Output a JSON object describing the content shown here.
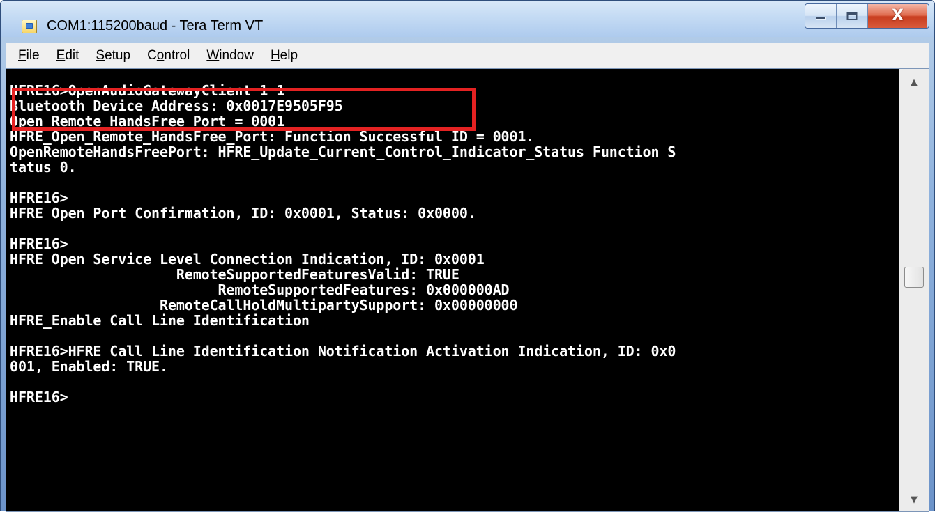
{
  "window": {
    "title": "COM1:115200baud - Tera Term VT",
    "app_icon": "tera-term-icon",
    "caption": {
      "minimize_icon": "minimize-icon",
      "maximize_icon": "maximize-icon",
      "close_icon": "close-icon",
      "close_glyph": "X",
      "close_color": "#d95a3b"
    }
  },
  "menu": {
    "items": [
      {
        "mnemonic": "F",
        "rest": "ile"
      },
      {
        "mnemonic": "E",
        "rest": "dit"
      },
      {
        "mnemonic": "S",
        "rest": "etup"
      },
      {
        "pre": "C",
        "mnemonic": "o",
        "rest": "ntrol"
      },
      {
        "mnemonic": "W",
        "rest": "indow"
      },
      {
        "mnemonic": "H",
        "rest": "elp"
      }
    ]
  },
  "terminal": {
    "background": "#000000",
    "foreground": "#ffffff",
    "highlight_color": "#e42222",
    "lines": [
      "HFRE16>OpenAudioGatewayClient 1 1",
      "Bluetooth Device Address: 0x0017E9505F95",
      "Open Remote HandsFree Port = 0001",
      "HFRE_Open_Remote_HandsFree_Port: Function Successful ID = 0001.",
      "OpenRemoteHandsFreePort: HFRE_Update_Current_Control_Indicator_Status Function S",
      "tatus 0.",
      "",
      "HFRE16>",
      "HFRE Open Port Confirmation, ID: 0x0001, Status: 0x0000.",
      "",
      "HFRE16>",
      "HFRE Open Service Level Connection Indication, ID: 0x0001",
      "                    RemoteSupportedFeaturesValid: TRUE",
      "                         RemoteSupportedFeatures: 0x000000AD",
      "                  RemoteCallHoldMultipartySupport: 0x00000000",
      "HFRE_Enable Call Line Identification",
      "",
      "HFRE16>HFRE Call Line Identification Notification Activation Indication, ID: 0x0",
      "001, Enabled: TRUE.",
      "",
      "HFRE16>"
    ]
  },
  "scrollbar": {
    "up_icon": "scroll-up-arrow-icon",
    "down_icon": "scroll-down-arrow-icon",
    "up_glyph": "▲",
    "down_glyph": "▼"
  }
}
